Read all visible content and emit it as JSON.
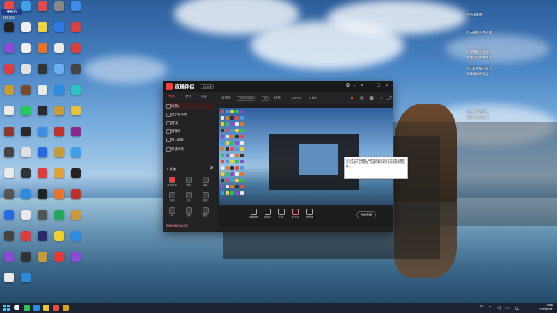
{
  "desktop": {
    "top_badge": "美丽的",
    "counter": "286983",
    "icons": [
      {
        "label": "",
        "color": "#e84a4a"
      },
      {
        "label": "",
        "color": "#3da0e8"
      },
      {
        "label": "",
        "color": "#e84a4a"
      },
      {
        "label": "",
        "color": "#888"
      },
      {
        "label": "",
        "color": "#3d8ee8"
      },
      {
        "label": "",
        "color": "#222"
      },
      {
        "label": "",
        "color": "#f0f0f0"
      },
      {
        "label": "",
        "color": "#f3d23a"
      },
      {
        "label": "",
        "color": "#2c7be5"
      },
      {
        "label": "",
        "color": "#d94040"
      },
      {
        "label": "",
        "color": "#8a4bd6"
      },
      {
        "label": "",
        "color": "#f0f0f0"
      },
      {
        "label": "",
        "color": "#e8742a"
      },
      {
        "label": "",
        "color": "#eaeaea"
      },
      {
        "label": "",
        "color": "#d94040"
      },
      {
        "label": "",
        "color": "#d94040"
      },
      {
        "label": "",
        "color": "#e0e0e0"
      },
      {
        "label": "",
        "color": "#333"
      },
      {
        "label": "",
        "color": "#6ab0f0"
      },
      {
        "label": "",
        "color": "#444"
      },
      {
        "label": "",
        "color": "#c79b3a"
      },
      {
        "label": "",
        "color": "#7a4b2a"
      },
      {
        "label": "",
        "color": "#eaeaea"
      },
      {
        "label": "",
        "color": "#2a8de0"
      },
      {
        "label": "",
        "color": "#2ec2c2"
      },
      {
        "label": "",
        "color": "#eaeaea"
      },
      {
        "label": "",
        "color": "#23c95a"
      },
      {
        "label": "",
        "color": "#2a2a2a"
      },
      {
        "label": "",
        "color": "#c79b3a"
      },
      {
        "label": "",
        "color": "#e6c23a"
      },
      {
        "label": "",
        "color": "#8a3a2a"
      },
      {
        "label": "",
        "color": "#2a2a2a"
      },
      {
        "label": "",
        "color": "#3d8ee8"
      },
      {
        "label": "",
        "color": "#c0302a"
      },
      {
        "label": "",
        "color": "#8a2a8a"
      },
      {
        "label": "",
        "color": "#444"
      },
      {
        "label": "",
        "color": "#e0e0e0"
      },
      {
        "label": "",
        "color": "#2a6ae0"
      },
      {
        "label": "",
        "color": "#c79b3a"
      },
      {
        "label": "",
        "color": "#3aa0e8"
      },
      {
        "label": "",
        "color": "#eaeaea"
      },
      {
        "label": "",
        "color": "#333"
      },
      {
        "label": "",
        "color": "#e03a3a"
      },
      {
        "label": "",
        "color": "#e0a03a"
      },
      {
        "label": "",
        "color": "#222"
      },
      {
        "label": "",
        "color": "#555"
      },
      {
        "label": "",
        "color": "#2a8de0"
      },
      {
        "label": "",
        "color": "#222"
      },
      {
        "label": "",
        "color": "#e8742a"
      },
      {
        "label": "",
        "color": "#c0302a"
      },
      {
        "label": "",
        "color": "#2a6ae0"
      },
      {
        "label": "",
        "color": "#eaeaea"
      },
      {
        "label": "",
        "color": "#555"
      },
      {
        "label": "",
        "color": "#23a85a"
      },
      {
        "label": "",
        "color": "#c79b3a"
      },
      {
        "label": "",
        "color": "#444"
      },
      {
        "label": "",
        "color": "#e03a3a"
      },
      {
        "label": "",
        "color": "#2a2a6a"
      },
      {
        "label": "",
        "color": "#f0d02a"
      },
      {
        "label": "",
        "color": "#2a8de0"
      },
      {
        "label": "",
        "color": "#8a4bd6"
      },
      {
        "label": "",
        "color": "#333"
      },
      {
        "label": "",
        "color": "#c79b3a"
      },
      {
        "label": "",
        "color": "#e03a3a"
      },
      {
        "label": "",
        "color": "#8a4bd6"
      },
      {
        "label": "",
        "color": "#eaeaea"
      },
      {
        "label": "",
        "color": "#2a8de0"
      }
    ]
  },
  "notes": {
    "line1": "请关注主播",
    "line2": "点击右侧头像关注",
    "line3": "欢迎来到直播间",
    "line4": "右侧可选择清晰度",
    "line5": "点击礼物按钮送礼",
    "line6": "弹幕请文明发言",
    "line7": "点击分享给好友",
    "line8": "感谢大家的支持"
  },
  "app": {
    "name": "直播伴侣",
    "version": "V2.0 ▾",
    "sidebar_tabs": [
      "场景",
      "素材",
      "设置"
    ],
    "scenes": [
      "场景1",
      "显示器采集",
      "游戏",
      "摄像头",
      "窗口捕获",
      "新建场景"
    ],
    "tools_title": "工具箱",
    "tools": [
      {
        "label": "直播设置",
        "name": "tool-live-settings"
      },
      {
        "label": "美颜",
        "name": "tool-beauty"
      },
      {
        "label": "弹幕",
        "name": "tool-danmaku"
      },
      {
        "label": "礼物",
        "name": "tool-gifts"
      },
      {
        "label": "音乐",
        "name": "tool-music"
      },
      {
        "label": "连麦",
        "name": "tool-mic-link"
      },
      {
        "label": "PK",
        "name": "tool-pk"
      },
      {
        "label": "录制",
        "name": "tool-record"
      },
      {
        "label": "更多",
        "name": "tool-more"
      }
    ],
    "bottom_tip": "开播前请检查设置",
    "topbar": {
      "left_text": "分辨率",
      "res_btn": "1920x1080",
      "fps_btn": "60",
      "bitrate_text": "码率",
      "stat1": "0 FPS",
      "stat2": "0 kb/s"
    },
    "control_bar": [
      {
        "label": "直播画面",
        "name": "ctrl-live-view"
      },
      {
        "label": "摄像头",
        "name": "ctrl-camera"
      },
      {
        "label": "分享",
        "name": "ctrl-share"
      },
      {
        "label": "麦克风",
        "name": "ctrl-mic"
      },
      {
        "label": "扬声器",
        "name": "ctrl-speaker"
      }
    ],
    "live_button": "开始直播",
    "tooltip": "点击此处开始直播，直播开始后您可以在此查看直播状态以及观众互动信息，如遇问题请联系客服获取帮助支持。"
  },
  "taskbar": {
    "time": "9:06",
    "date": "2023/3/21"
  }
}
